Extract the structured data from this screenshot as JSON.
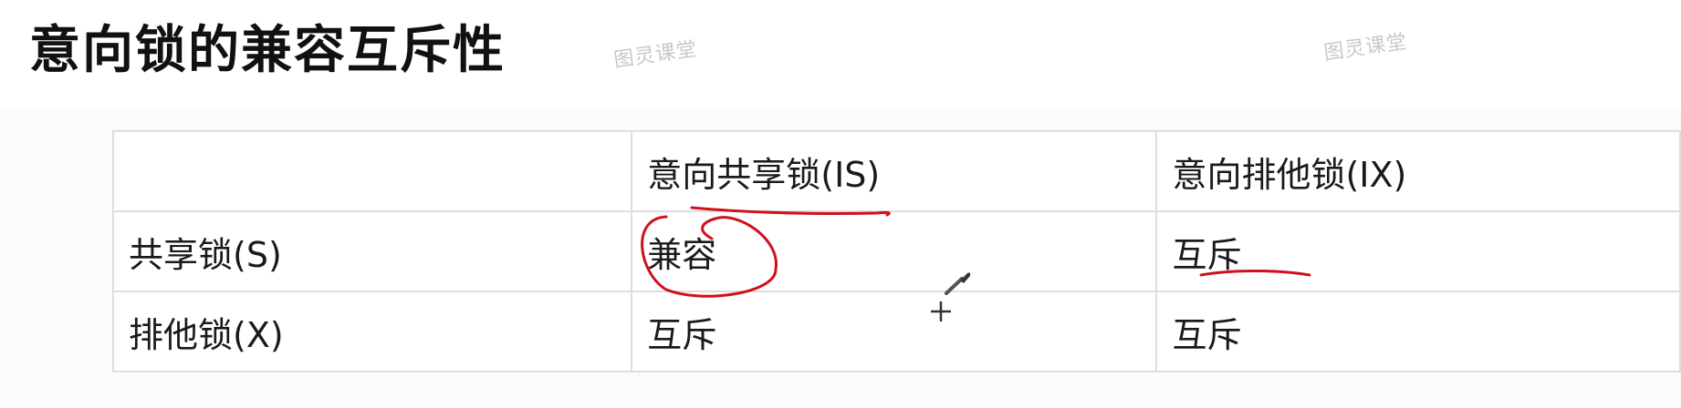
{
  "page": {
    "title": "意向锁的兼容互斥性",
    "watermark": "图灵课堂"
  },
  "table": {
    "headers": [
      "",
      "意向共享锁(IS)",
      "意向排他锁(IX)"
    ],
    "rows": [
      {
        "label": "共享锁(S)",
        "cells": [
          "兼容",
          "互斥"
        ]
      },
      {
        "label": "排他锁(X)",
        "cells": [
          "互斥",
          "互斥"
        ]
      }
    ]
  },
  "annotations": {
    "ink_color": "#d0101c",
    "marks": [
      "underline-header-is",
      "circle-cell-compatible",
      "underline-cell-exclusive"
    ]
  },
  "cursor": {
    "icon": "brush-crosshair-icon"
  }
}
